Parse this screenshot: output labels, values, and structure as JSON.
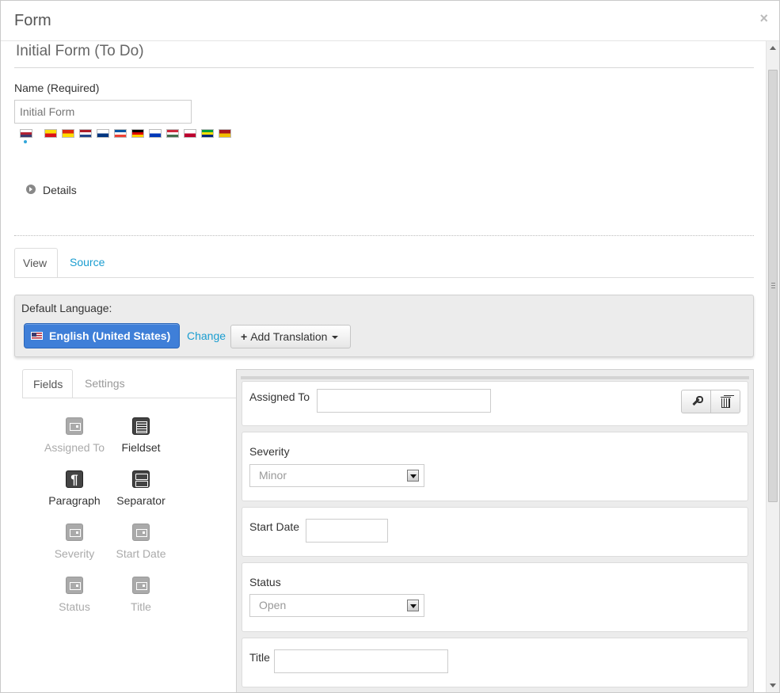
{
  "modal": {
    "title": "Form",
    "close_label": "×"
  },
  "form": {
    "title": "Initial Form (To Do)",
    "name_label": "Name (Required)",
    "name_placeholder": "Initial Form"
  },
  "flags": [
    {
      "name": "flag-us-icon",
      "colors": [
        "#ffffff",
        "#b22234",
        "#3c3b6e"
      ]
    },
    {
      "name": "flag-catalonia-icon",
      "colors": [
        "#fcdd09",
        "#da121a"
      ]
    },
    {
      "name": "flag-china-icon",
      "colors": [
        "#de2910",
        "#ffde00"
      ]
    },
    {
      "name": "flag-netherlands-icon",
      "colors": [
        "#ae1c28",
        "#ffffff",
        "#21468b"
      ]
    },
    {
      "name": "flag-finland-icon",
      "colors": [
        "#ffffff",
        "#003580"
      ]
    },
    {
      "name": "flag-france-icon",
      "colors": [
        "#0055a4",
        "#ffffff",
        "#ef4135"
      ]
    },
    {
      "name": "flag-germany-icon",
      "colors": [
        "#000000",
        "#dd0000",
        "#ffce00"
      ]
    },
    {
      "name": "flag-israel-icon",
      "colors": [
        "#ffffff",
        "#0038b8"
      ]
    },
    {
      "name": "flag-hungary-icon",
      "colors": [
        "#cd2a3e",
        "#ffffff",
        "#436f4d"
      ]
    },
    {
      "name": "flag-japan-icon",
      "colors": [
        "#ffffff",
        "#bc002d"
      ]
    },
    {
      "name": "flag-brazil-icon",
      "colors": [
        "#009c3b",
        "#ffdf00",
        "#002776"
      ]
    },
    {
      "name": "flag-spain-icon",
      "colors": [
        "#aa151b",
        "#f1bf00"
      ]
    }
  ],
  "details": {
    "label": "Details"
  },
  "tabs": [
    {
      "label": "View",
      "active": true
    },
    {
      "label": "Source",
      "active": false
    }
  ],
  "language": {
    "label": "Default Language:",
    "current": "English (United States)",
    "change_label": "Change",
    "add_translation_label": "Add Translation"
  },
  "side_tabs": [
    {
      "label": "Fields",
      "active": true
    },
    {
      "label": "Settings",
      "active": false
    }
  ],
  "palette": [
    {
      "label": "Assigned To",
      "enabled": false
    },
    {
      "label": "Fieldset",
      "enabled": true
    },
    {
      "label": "Paragraph",
      "enabled": true
    },
    {
      "label": "Separator",
      "enabled": true
    },
    {
      "label": "Severity",
      "enabled": false
    },
    {
      "label": "Start Date",
      "enabled": false
    },
    {
      "label": "Status",
      "enabled": false
    },
    {
      "label": "Title",
      "enabled": false
    }
  ],
  "fields": {
    "assigned_to": {
      "label": "Assigned To"
    },
    "severity": {
      "label": "Severity",
      "value": "Minor"
    },
    "start_date": {
      "label": "Start Date"
    },
    "status": {
      "label": "Status",
      "value": "Open"
    },
    "title": {
      "label": "Title"
    }
  },
  "colors": {
    "accent": "#3f7fd8",
    "link": "#1a9dd0"
  }
}
